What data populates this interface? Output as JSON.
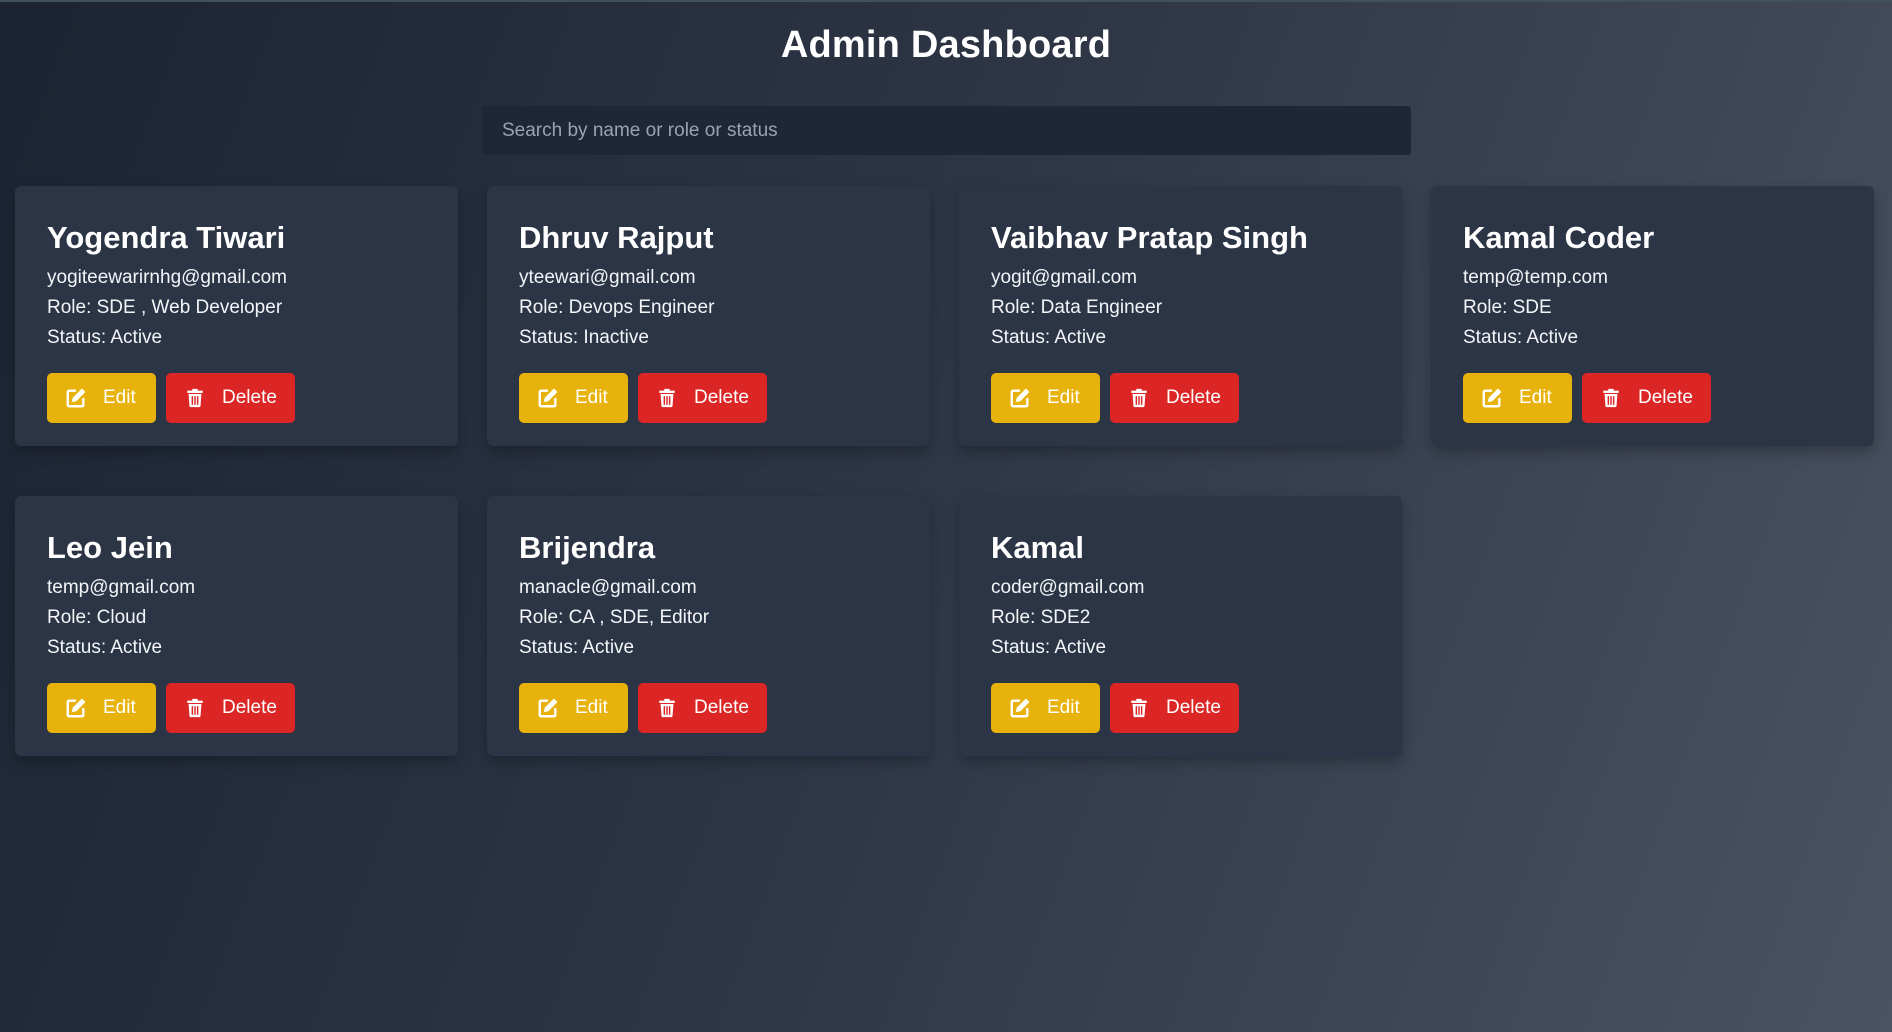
{
  "page": {
    "title": "Admin Dashboard"
  },
  "search": {
    "placeholder": "Search by name or role or status",
    "value": ""
  },
  "labels": {
    "role_prefix": "Role: ",
    "status_prefix": "Status: ",
    "edit": "Edit",
    "delete": "Delete"
  },
  "colors": {
    "edit_button": "#e8b20c",
    "delete_button": "#dc2626",
    "card_background": "#2c3545"
  },
  "icons": {
    "edit": "edit-icon",
    "delete": "trash-icon"
  },
  "users": [
    {
      "name": "Yogendra Tiwari",
      "email": "yogiteewarirnhg@gmail.com",
      "role": "Role: SDE , Web Developer",
      "status": "Status: Active"
    },
    {
      "name": "Dhruv Rajput",
      "email": "yteewari@gmail.com",
      "role": "Role: Devops Engineer",
      "status": "Status: Inactive"
    },
    {
      "name": "Vaibhav Pratap Singh",
      "email": "yogit@gmail.com",
      "role": "Role: Data Engineer",
      "status": "Status: Active"
    },
    {
      "name": "Kamal Coder",
      "email": "temp@temp.com",
      "role": "Role: SDE",
      "status": "Status: Active"
    },
    {
      "name": "Leo Jein",
      "email": "temp@gmail.com",
      "role": "Role: Cloud",
      "status": "Status: Active"
    },
    {
      "name": "Brijendra",
      "email": "manacle@gmail.com",
      "role": "Role: CA , SDE, Editor",
      "status": "Status: Active"
    },
    {
      "name": "Kamal",
      "email": "coder@gmail.com",
      "role": "Role: SDE2",
      "status": "Status: Active"
    }
  ]
}
